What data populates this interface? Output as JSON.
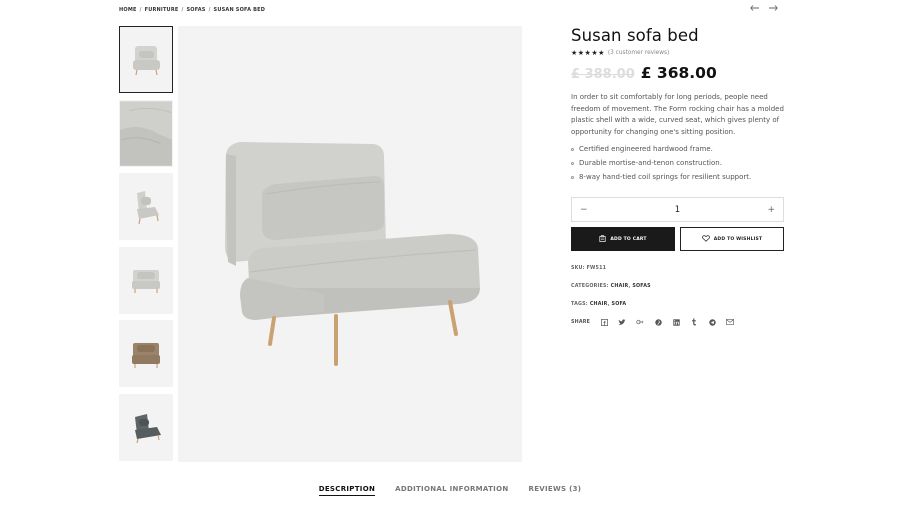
{
  "breadcrumb": {
    "home": "HOME",
    "furniture": "FURNITURE",
    "sofas": "SOFAS",
    "current": "SUSAN SOFA BED",
    "separator": "/"
  },
  "nav": {
    "prev_icon": "arrow-left-icon",
    "next_icon": "arrow-right-icon"
  },
  "gallery": {
    "thumbnails": [
      {
        "name": "thumb-front-grey",
        "color": "#cfcfcc",
        "active": true
      },
      {
        "name": "thumb-detail-closeup",
        "color": "#cfcfcc",
        "active": false
      },
      {
        "name": "thumb-side-grey",
        "color": "#cfcfcc",
        "active": false
      },
      {
        "name": "thumb-front-flat",
        "color": "#cfcfcc",
        "active": false
      },
      {
        "name": "thumb-brown",
        "color": "#8f7a62",
        "active": false
      },
      {
        "name": "thumb-dark-grey",
        "color": "#5a5f61",
        "active": false
      }
    ],
    "main_color": "#cdcdca"
  },
  "product": {
    "title": "Susan sofa bed",
    "stars": "★★★★★",
    "reviews_link": "(3 customer reviews)",
    "price_old": "£ 388.00",
    "price_new": "£ 368.00",
    "description": "In order to sit comfortably for long periods, people need freedom of movement. The Form rocking chair has a molded plastic shell with a wide, curved seat, which gives plenty of opportunity for changing one's sitting position.",
    "features": [
      "Certified engineered hardwood frame.",
      "Durable mortise-and-tenon construction.",
      "8-way hand-tied coil springs for resilient support."
    ]
  },
  "quantity": {
    "minus": "−",
    "value": "1",
    "plus": "+"
  },
  "buttons": {
    "add_to_cart": "ADD TO CART",
    "add_to_wishlist": "ADD TO WISHLIST"
  },
  "meta": {
    "sku_label": "SKU:",
    "sku_value": "FW511",
    "categories_label": "CATEGORIES:",
    "categories": [
      "CHAIR",
      "SOFAS"
    ],
    "tags_label": "TAGS:",
    "tags": [
      "CHAIR",
      "SOFA"
    ],
    "share_label": "SHARE"
  },
  "share_icons": [
    "facebook-icon",
    "twitter-icon",
    "google-plus-icon",
    "pinterest-icon",
    "linkedin-icon",
    "tumblr-icon",
    "telegram-icon",
    "email-icon"
  ],
  "tabs": [
    {
      "label": "DESCRIPTION",
      "active": true
    },
    {
      "label": "ADDITIONAL INFORMATION",
      "active": false
    },
    {
      "label": "REVIEWS (3)",
      "active": false
    }
  ]
}
